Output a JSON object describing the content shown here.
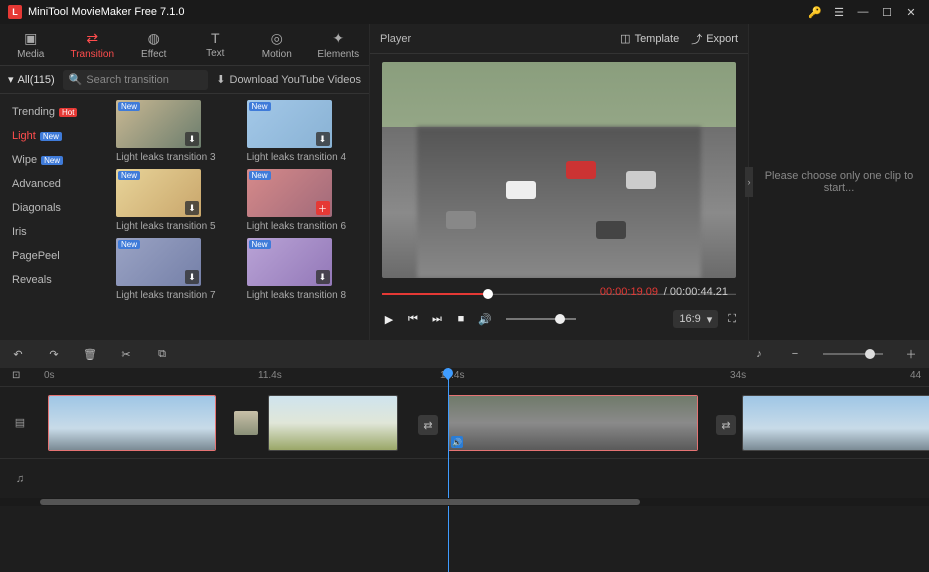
{
  "app": {
    "title": "MiniTool MovieMaker Free 7.1.0"
  },
  "tabs": [
    {
      "id": "media",
      "label": "Media"
    },
    {
      "id": "transition",
      "label": "Transition"
    },
    {
      "id": "effect",
      "label": "Effect"
    },
    {
      "id": "text",
      "label": "Text"
    },
    {
      "id": "motion",
      "label": "Motion"
    },
    {
      "id": "elements",
      "label": "Elements"
    }
  ],
  "subbar": {
    "all": "All(115)",
    "search_placeholder": "Search transition",
    "download": "Download YouTube Videos"
  },
  "categories": [
    {
      "label": "Trending",
      "badge": "hot"
    },
    {
      "label": "Light",
      "badge": "new",
      "active": true
    },
    {
      "label": "Wipe",
      "badge": "new"
    },
    {
      "label": "Advanced"
    },
    {
      "label": "Diagonals"
    },
    {
      "label": "Iris"
    },
    {
      "label": "PagePeel"
    },
    {
      "label": "Reveals"
    }
  ],
  "thumbs": [
    {
      "label": "Light leaks transition 3"
    },
    {
      "label": "Light leaks transition 4"
    },
    {
      "label": "Light leaks transition 5"
    },
    {
      "label": "Light leaks transition 6",
      "add": true
    },
    {
      "label": "Light leaks transition 7"
    },
    {
      "label": "Light leaks transition 8"
    }
  ],
  "player": {
    "title": "Player",
    "template": "Template",
    "export": "Export",
    "cur_time": "00:00:19.09",
    "sep": " / ",
    "total_time": "00:00:44.21",
    "ratio": "16:9"
  },
  "props": {
    "msg": "Please choose only one clip to start..."
  },
  "ruler": {
    "t0": "0s",
    "t1": "11.4s",
    "t2": "19.4s",
    "t3": "34s",
    "t4": "44"
  },
  "badges": {
    "hot_text": "Hot",
    "new_text": "New"
  }
}
